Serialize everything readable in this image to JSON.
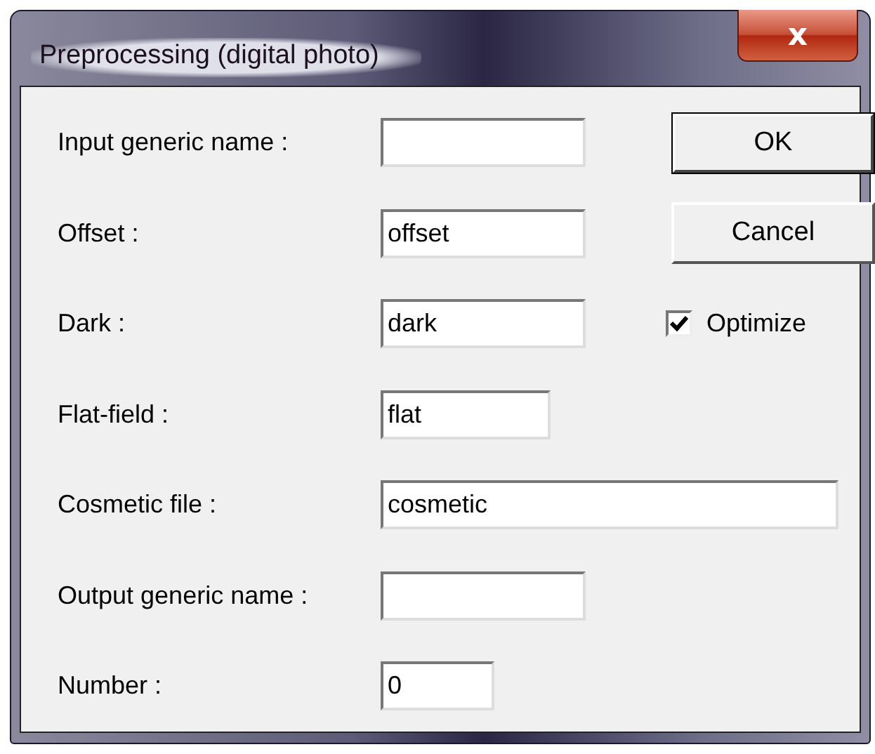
{
  "window": {
    "title": "Preprocessing (digital photo)",
    "close": "x"
  },
  "fields": [
    {
      "label": "Input generic name :"
    },
    {
      "label": "Offset :",
      "value": "offset"
    },
    {
      "label": "Dark :",
      "value": "dark"
    },
    {
      "label": "Flat-field :",
      "value": "flat"
    },
    {
      "label": "Cosmetic file :",
      "value": "cosmetic"
    },
    {
      "label": "Output generic name :"
    },
    {
      "label": "Number :",
      "value": "0"
    }
  ],
  "buttons": [
    {
      "label": "OK",
      "default": true
    },
    {
      "label": "Cancel",
      "default": false
    }
  ],
  "checkbox": {
    "label": "Optimize",
    "checked": true
  }
}
